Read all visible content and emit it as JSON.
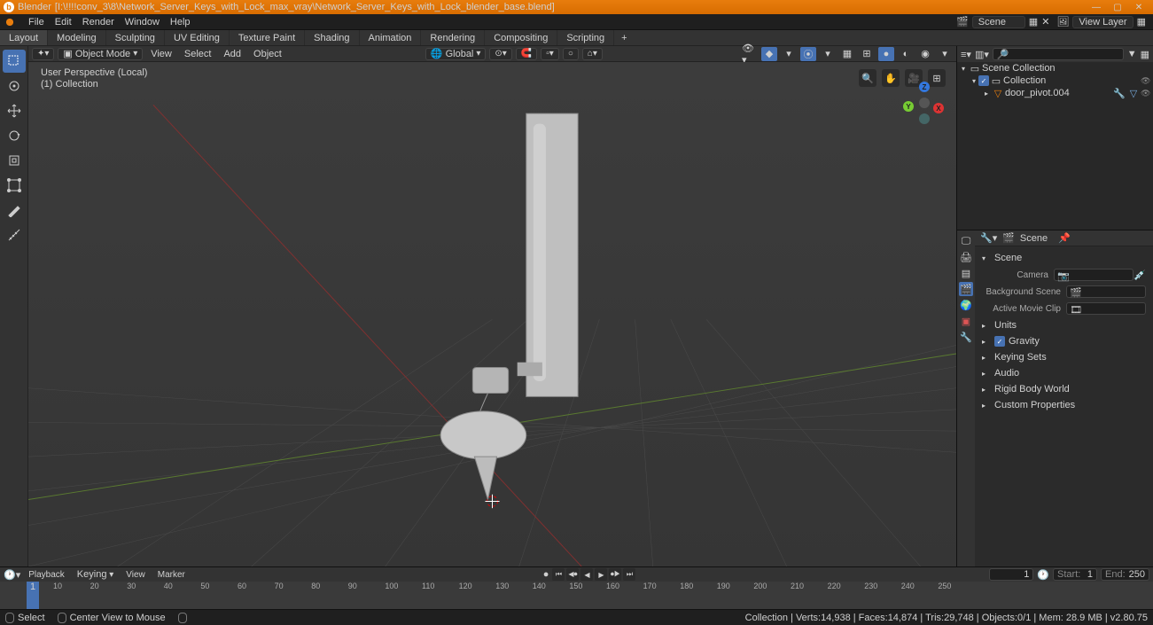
{
  "titlebar": {
    "app": "Blender",
    "file": "[I:\\!!!!conv_3\\8\\Network_Server_Keys_with_Lock_max_vray\\Network_Server_Keys_with_Lock_blender_base.blend]"
  },
  "menubar": {
    "items": [
      "File",
      "Edit",
      "Render",
      "Window",
      "Help"
    ],
    "scene_label": "Scene",
    "viewlayer_label": "View Layer"
  },
  "workspaces": [
    "Layout",
    "Modeling",
    "Sculpting",
    "UV Editing",
    "Texture Paint",
    "Shading",
    "Animation",
    "Rendering",
    "Compositing",
    "Scripting"
  ],
  "workspace_active": 0,
  "vp_header": {
    "mode": "Object Mode",
    "menus": [
      "View",
      "Select",
      "Add",
      "Object"
    ],
    "orientation": "Global"
  },
  "vp_overlay": {
    "line1": "User Perspective (Local)",
    "line2": "(1) Collection"
  },
  "outliner": {
    "root": "Scene Collection",
    "collection": "Collection",
    "item": "door_pivot.004"
  },
  "props": {
    "breadcrumb": "Scene",
    "panel_scene": "Scene",
    "rows": {
      "camera": "Camera",
      "bg_scene": "Background Scene",
      "clip": "Active Movie Clip"
    },
    "panels": [
      "Units",
      "Gravity",
      "Keying Sets",
      "Audio",
      "Rigid Body World",
      "Custom Properties"
    ]
  },
  "timeline": {
    "menus": [
      "Playback",
      "Keying",
      "View",
      "Marker"
    ],
    "current": "1",
    "start_label": "Start:",
    "start": "1",
    "end_label": "End:",
    "end": "250",
    "ticks": [
      "10",
      "20",
      "30",
      "40",
      "50",
      "60",
      "70",
      "80",
      "90",
      "100",
      "110",
      "120",
      "130",
      "140",
      "150",
      "160",
      "170",
      "180",
      "190",
      "200",
      "210",
      "220",
      "230",
      "240",
      "250"
    ],
    "playhead": "1"
  },
  "status": {
    "hint_select": "Select",
    "hint_center": "Center View to Mouse",
    "right": "Collection | Verts:14,938 | Faces:14,874 | Tris:29,748 | Objects:0/1 | Mem: 28.9 MB | v2.80.75"
  }
}
